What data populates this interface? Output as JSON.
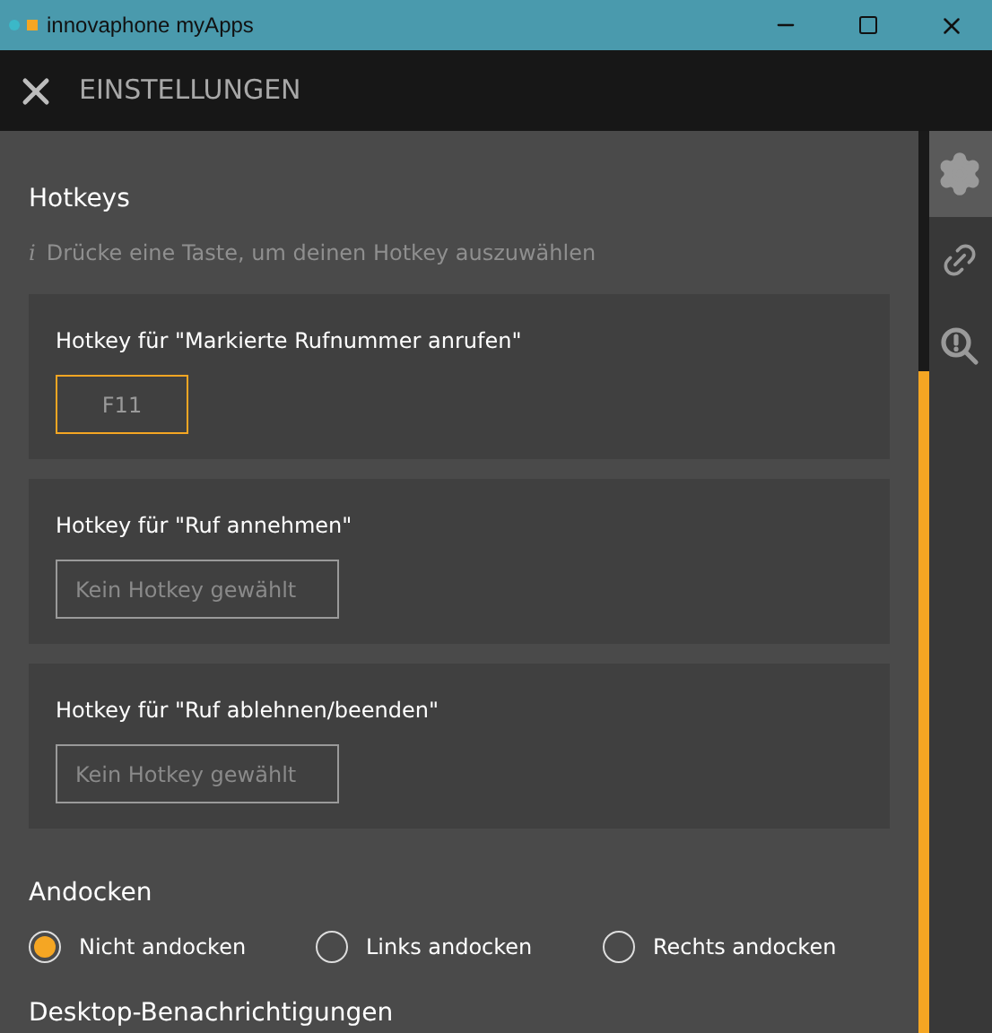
{
  "window": {
    "title": "innovaphone myApps"
  },
  "header": {
    "title": "EINSTELLUNGEN"
  },
  "hotkeys": {
    "title": "Hotkeys",
    "info_icon": "i",
    "hint": "Drücke eine Taste, um deinen Hotkey auszuwählen",
    "items": [
      {
        "label": "Hotkey für \"Markierte Rufnummer anrufen\"",
        "value": "F11",
        "focused": true
      },
      {
        "label": "Hotkey für \"Ruf annehmen\"",
        "placeholder": "Kein Hotkey gewählt",
        "focused": false
      },
      {
        "label": "Hotkey für \"Ruf ablehnen/beenden\"",
        "placeholder": "Kein Hotkey gewählt",
        "focused": false
      }
    ]
  },
  "docking": {
    "title": "Andocken",
    "options": [
      {
        "label": "Nicht andocken",
        "selected": true
      },
      {
        "label": "Links andocken",
        "selected": false
      },
      {
        "label": "Rechts andocken",
        "selected": false
      }
    ]
  },
  "next_section": {
    "title": "Desktop-Benachrichtigungen"
  },
  "sidebar": {
    "items": [
      {
        "kind": "settings",
        "selected": true
      },
      {
        "kind": "link",
        "selected": false
      },
      {
        "kind": "diagnostics",
        "selected": false
      }
    ]
  }
}
